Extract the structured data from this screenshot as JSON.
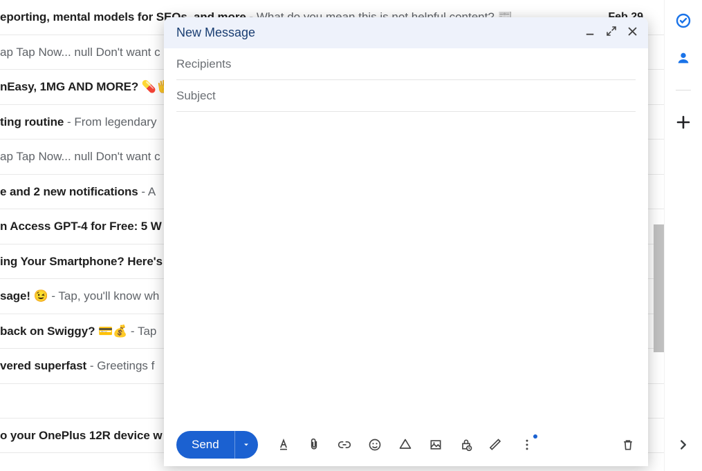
{
  "emails": [
    {
      "subject": "eporting, mental models for SEOs, and more",
      "preview": "What do you mean this is not helpful content? 📰",
      "date": "Feb 29"
    },
    {
      "subject": "",
      "preview": "ap Tap Now... null Don't want c",
      "date": ""
    },
    {
      "subject": "nEasy, 1MG AND MORE? 💊🖐",
      "preview": "",
      "date": ""
    },
    {
      "subject": "ting routine",
      "preview": "From legendary",
      "date": ""
    },
    {
      "subject": "",
      "preview": "ap Tap Now... null Don't want c",
      "date": ""
    },
    {
      "subject": "e and 2 new notifications",
      "preview": "A",
      "date": ""
    },
    {
      "subject": "n Access GPT-4 for Free: 5 W",
      "preview": "",
      "date": ""
    },
    {
      "subject": "ing Your Smartphone? Here's",
      "preview": "",
      "date": ""
    },
    {
      "subject": "sage! 😉",
      "preview": "Tap, you'll know wh",
      "date": ""
    },
    {
      "subject": "back on Swiggy? 💳💰",
      "preview": "Tap ",
      "date": ""
    },
    {
      "subject": "vered superfast",
      "preview": "Greetings f",
      "date": ""
    },
    {
      "subject": "o your OnePlus 12R device w",
      "preview": "",
      "date": ""
    }
  ],
  "compose": {
    "title": "New Message",
    "recipients_placeholder": "Recipients",
    "subject_placeholder": "Subject",
    "send_label": "Send"
  }
}
